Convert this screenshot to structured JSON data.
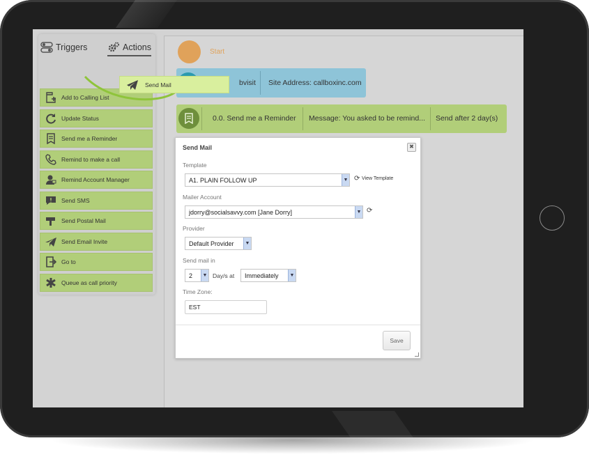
{
  "tabs": {
    "triggers_label": "Triggers",
    "actions_label": "Actions"
  },
  "actions": [
    {
      "label": "Add to Calling List",
      "icon": "add-list-icon"
    },
    {
      "label": "Update Status",
      "icon": "refresh-icon"
    },
    {
      "label": "Send me a Reminder",
      "icon": "bookmark-icon"
    },
    {
      "label": "Remind to make a call",
      "icon": "phone-icon"
    },
    {
      "label": "Remind Account Manager",
      "icon": "account-manager-icon"
    },
    {
      "label": "Send SMS",
      "icon": "sms-icon"
    },
    {
      "label": "Send Postal Mail",
      "icon": "mailbox-icon"
    },
    {
      "label": "Send Email Invite",
      "icon": "email-invite-icon"
    },
    {
      "label": "Go to",
      "icon": "goto-icon"
    },
    {
      "label": "Queue as call priority",
      "icon": "asterisk-icon"
    }
  ],
  "drag_ghost": {
    "label": "Send Mail",
    "icon": "paper-plane-icon"
  },
  "flow": {
    "start_label": "Start",
    "web_node": {
      "segment1": "bvisit",
      "segment2": "Site Address: callboxinc.com"
    },
    "reminder_node": {
      "segment1": "0.0. Send me a Reminder",
      "segment2": "Message: You asked to be remind...",
      "segment3": "Send after 2 day(s)"
    }
  },
  "modal": {
    "title": "Send Mail",
    "close_symbol": "✖",
    "template_label": "Template",
    "template_value": "A1. PLAIN FOLLOW UP",
    "view_template_label": "View Template",
    "mailer_label": "Mailer Account",
    "mailer_value": "jdorry@socialsavvy.com [Jane Dorry]",
    "provider_label": "Provider",
    "provider_value": "Default Provider",
    "send_in_label": "Send mail in",
    "days_value": "2",
    "days_at_label": "Day/s at",
    "time_value": "Immediately",
    "timezone_label": "Time Zone:",
    "timezone_value": "EST",
    "save_label": "Save"
  },
  "colors": {
    "action_green": "#b1ce79",
    "start_orange": "#e0a25a",
    "web_blue": "#8ec4d8",
    "tablet_frame": "#1f1f1f"
  }
}
